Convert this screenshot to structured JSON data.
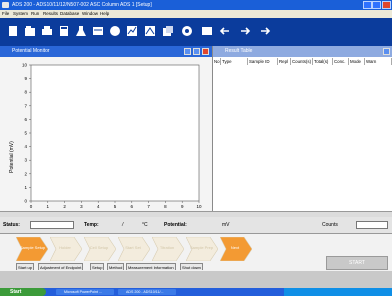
{
  "window": {
    "title": "ADS 200 - ADS10/11/12/N507-002 ASC Column ADS 1 [Setup]"
  },
  "menu": {
    "items": [
      "File",
      "System",
      "Run",
      "Results",
      "Database",
      "Window",
      "Help"
    ]
  },
  "toolbar": {
    "icons": [
      "new-icon",
      "open-icon",
      "print-icon",
      "calc-icon",
      "flask-icon",
      "method-icon",
      "sample-icon",
      "analysis-icon",
      "report-icon",
      "database-icon",
      "settings-icon",
      "back-arrow-icon",
      "forward-arrow-icon",
      "next-arrow-icon"
    ]
  },
  "left_panel": {
    "title": "Potential Monitor",
    "chart_data": {
      "type": "line",
      "title": "",
      "xlabel": "",
      "ylabel": "Potential (mV)",
      "x_ticks": [
        "0",
        "1",
        "2",
        "3",
        "4",
        "5",
        "6",
        "7",
        "8",
        "9",
        "10"
      ],
      "y_ticks": [
        "0",
        "1",
        "2",
        "3",
        "4",
        "5",
        "6",
        "7",
        "8",
        "9",
        "10"
      ],
      "xlim": [
        0,
        10
      ],
      "ylim": [
        0,
        10
      ],
      "series": [],
      "grid": false
    }
  },
  "right_panel": {
    "title": "Result Table",
    "columns": [
      "No",
      "Type",
      "Sample ID",
      "Repl",
      "Counts(s)",
      "Total(s)",
      "Conc.",
      "Mode",
      "Warn"
    ]
  },
  "status": {
    "status_label": "Status:",
    "temp_label": "Temp:",
    "temp_value": "/",
    "temp_unit": "°C",
    "potential_label": "Potential:",
    "potential_unit": "mV",
    "counts_label": "Counts"
  },
  "workflow": {
    "steps": [
      "Sample Setup",
      "Holder",
      "Cell Setup",
      "Start Set",
      "Titration",
      "Sample Prep",
      "Next"
    ],
    "active_indices": [
      0,
      6
    ],
    "tabs": [
      "Start up",
      "Adjustment of Endpoint",
      "Setup",
      "Method",
      "Measurement Information",
      "Shut down"
    ],
    "start_button": "START"
  },
  "taskbar": {
    "start": "Start",
    "tasks": [
      "Microsoft PowerPoint ...",
      "ADS 200 - ADS10/11/..."
    ]
  },
  "colors": {
    "titlebar": "#1a5fd8",
    "toolbar": "#0b3c9c",
    "active_step": "#f39a33",
    "inactive_step": "#f3ecdd",
    "taskbar": "#245edb"
  }
}
